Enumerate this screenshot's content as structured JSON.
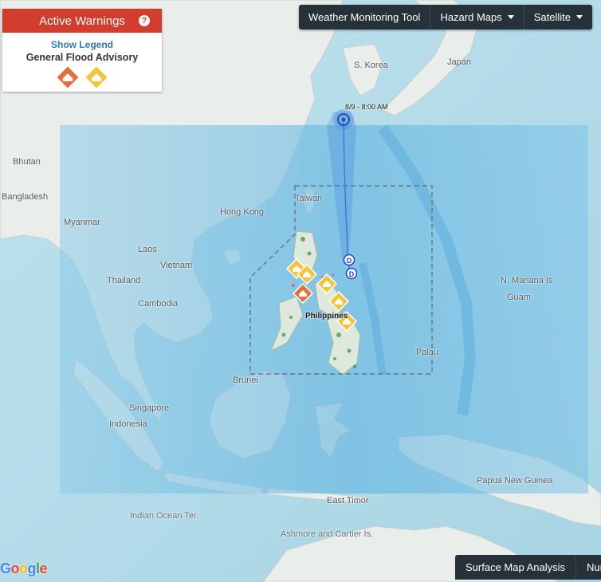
{
  "warnings_panel": {
    "title": "Active Warnings",
    "help": "?",
    "show_legend": "Show Legend",
    "advisory": "General Flood Advisory"
  },
  "toolbar": {
    "tool": "Weather Monitoring Tool",
    "hazard": "Hazard Maps",
    "satellite": "Satellite"
  },
  "bottom_bar": {
    "surface": "Surface Map Analysis",
    "num": "Num"
  },
  "storm": {
    "time_label": "8/9 - 8:00 AM",
    "depression_symbol": "D"
  },
  "places": {
    "korea": "S. Korea",
    "japan": "Japan",
    "bhutan": "Bhutan",
    "bangladesh": "Bangladesh",
    "taiwan": "Taiwan",
    "hongkong": "Hong Kong",
    "myanmar": "Myanmar",
    "laos": "Laos",
    "vietnam": "Vietnam",
    "thailand": "Thailand",
    "cambodia": "Cambodia",
    "philippines": "Philippines",
    "mariana": "N. Mariana Is",
    "guam": "Guam",
    "palau": "Palau",
    "brunei": "Brunei",
    "singapore": "Singapore",
    "indonesia": "Indonesia",
    "png": "Papua New Guinea",
    "easttimor": "East Timor",
    "indianocean": "Indian Ocean Ter.",
    "ashmore": "Ashmore and Cartier Is."
  },
  "attribution": "Google",
  "colors": {
    "severe": "#e2703f",
    "advisory": "#f4c53a",
    "panel_header": "#d23d2d",
    "toolbar": "#27313a",
    "track": "#2f6fd6"
  },
  "icons": {
    "flood": "house-flood-icon",
    "help": "help-icon",
    "caret": "caret-down-icon"
  }
}
